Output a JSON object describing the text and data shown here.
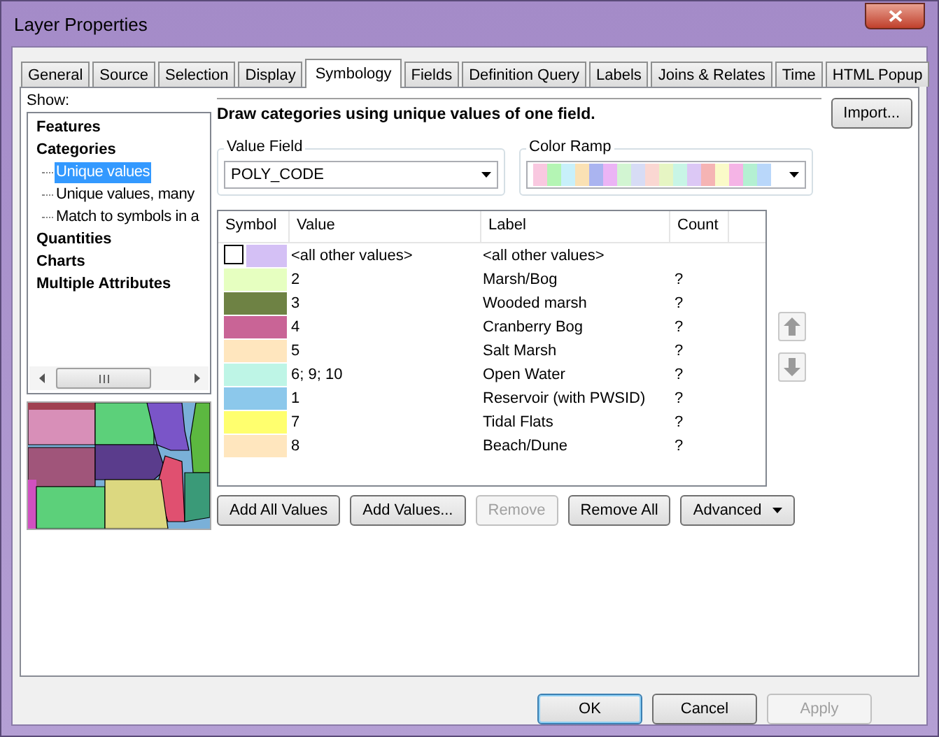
{
  "window": {
    "title": "Layer Properties"
  },
  "tabs": [
    {
      "label": "General",
      "selected": false
    },
    {
      "label": "Source",
      "selected": false
    },
    {
      "label": "Selection",
      "selected": false
    },
    {
      "label": "Display",
      "selected": false
    },
    {
      "label": "Symbology",
      "selected": true
    },
    {
      "label": "Fields",
      "selected": false
    },
    {
      "label": "Definition Query",
      "selected": false
    },
    {
      "label": "Labels",
      "selected": false
    },
    {
      "label": "Joins & Relates",
      "selected": false
    },
    {
      "label": "Time",
      "selected": false
    },
    {
      "label": "HTML Popup",
      "selected": false
    }
  ],
  "show": {
    "label": "Show:",
    "tree": [
      {
        "label": "Features"
      },
      {
        "label": "Categories",
        "children": [
          {
            "label": "Unique values",
            "selected": true
          },
          {
            "label": "Unique values, many",
            "selected": false
          },
          {
            "label": "Match to symbols in a",
            "selected": false
          }
        ]
      },
      {
        "label": "Quantities"
      },
      {
        "label": "Charts"
      },
      {
        "label": "Multiple Attributes"
      }
    ]
  },
  "description": "Draw categories using unique values of one field.",
  "import_button": "Import...",
  "value_field": {
    "label": "Value Field",
    "value": "POLY_CODE"
  },
  "color_ramp": {
    "label": "Color Ramp"
  },
  "table": {
    "columns": [
      "Symbol",
      "Value",
      "Label",
      "Count"
    ],
    "other_row": {
      "checked": false,
      "color": "#d4c0f5",
      "value": "<all other values>",
      "label": "<all other values>"
    },
    "rows": [
      {
        "color": "#e6ffc0",
        "value": "2",
        "label": "Marsh/Bog",
        "count": "?"
      },
      {
        "color": "#6e8244",
        "value": "3",
        "label": "Wooded marsh",
        "count": "?"
      },
      {
        "color": "#c96496",
        "value": "4",
        "label": "Cranberry Bog",
        "count": "?"
      },
      {
        "color": "#ffe6be",
        "value": "5",
        "label": "Salt Marsh",
        "count": "?"
      },
      {
        "color": "#bef5e6",
        "value": "6; 9; 10",
        "label": "Open Water",
        "count": "?"
      },
      {
        "color": "#8cc8eb",
        "value": "1",
        "label": "Reservoir (with PWSID)",
        "count": "?"
      },
      {
        "color": "#ffff6e",
        "value": "7",
        "label": "Tidal Flats",
        "count": "?"
      },
      {
        "color": "#ffe6be",
        "value": "8",
        "label": "Beach/Dune",
        "count": "?"
      }
    ]
  },
  "table_buttons": [
    {
      "label": "Add All Values",
      "disabled": false
    },
    {
      "label": "Add Values...",
      "disabled": false
    },
    {
      "label": "Remove",
      "disabled": true
    },
    {
      "label": "Remove All",
      "disabled": false
    }
  ],
  "advanced_button": "Advanced",
  "dialog_buttons": [
    {
      "label": "OK",
      "disabled": false
    },
    {
      "label": "Cancel",
      "disabled": false
    },
    {
      "label": "Apply",
      "disabled": true
    }
  ]
}
